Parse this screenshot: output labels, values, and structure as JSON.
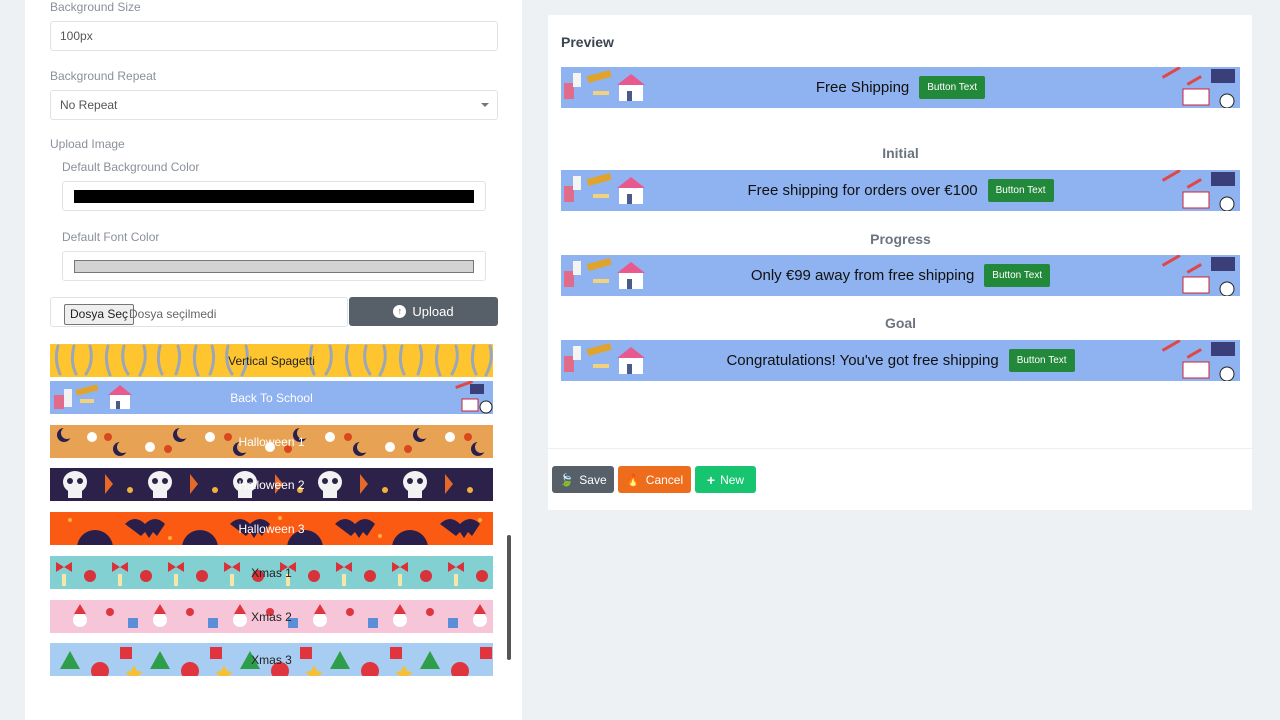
{
  "form": {
    "background_size_label": "Background Size",
    "background_size_value": "100px",
    "background_repeat_label": "Background Repeat",
    "background_repeat_value": "No Repeat",
    "upload_image_label": "Upload Image",
    "default_bg_color_label": "Default Background Color",
    "default_bg_color_value": "#000000",
    "default_font_color_label": "Default Font Color",
    "default_font_color_value": "#d3d3d3",
    "file_button_label": "Dosya Seç",
    "file_status": "Dosya seçilmedi",
    "upload_label": "Upload"
  },
  "backgrounds": [
    {
      "name": "Vertical Spagetti",
      "color": "#ffc52e",
      "text_color": "#222222"
    },
    {
      "name": "Back To School",
      "color": "#8fb2f0",
      "text_color": "#ffffff"
    },
    {
      "name": "Halloween 1",
      "color": "#e8a254",
      "text_color": "#ffffff"
    },
    {
      "name": "Halloween 2",
      "color": "#2c2148",
      "text_color": "#ffffff"
    },
    {
      "name": "Halloween 3",
      "color": "#fa5a12",
      "text_color": "#ffffff"
    },
    {
      "name": "Xmas 1",
      "color": "#82d0d2",
      "text_color": "#222222"
    },
    {
      "name": "Xmas 2",
      "color": "#f7c5d8",
      "text_color": "#222222"
    },
    {
      "name": "Xmas 3",
      "color": "#a8cdf2",
      "text_color": "#222222"
    }
  ],
  "preview": {
    "title": "Preview",
    "banner_color": "#8fb2f0",
    "button_color": "#23893a",
    "main": {
      "text": "Free Shipping",
      "button": "Button Text"
    },
    "initial": {
      "label": "Initial",
      "text": "Free shipping for orders over €100",
      "button": "Button Text"
    },
    "progress": {
      "label": "Progress",
      "text": "Only €99 away from free shipping",
      "button": "Button Text"
    },
    "goal": {
      "label": "Goal",
      "text": "Congratulations! You've got free shipping",
      "button": "Button Text"
    }
  },
  "actions": {
    "save": "Save",
    "cancel": "Cancel",
    "new": "New"
  }
}
